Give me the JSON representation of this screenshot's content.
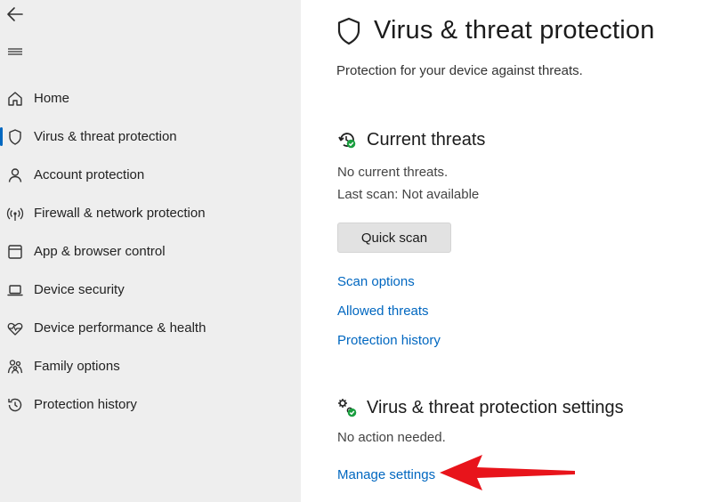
{
  "sidebar": {
    "back_icon": "back-arrow-icon",
    "menu_icon": "hamburger-menu-icon",
    "items": [
      {
        "label": "Home",
        "icon": "home-icon",
        "active": false
      },
      {
        "label": "Virus & threat protection",
        "icon": "shield-icon",
        "active": true
      },
      {
        "label": "Account protection",
        "icon": "person-icon",
        "active": false
      },
      {
        "label": "Firewall & network protection",
        "icon": "wireless-icon",
        "active": false
      },
      {
        "label": "App & browser control",
        "icon": "app-window-icon",
        "active": false
      },
      {
        "label": "Device security",
        "icon": "laptop-icon",
        "active": false
      },
      {
        "label": "Device performance & health",
        "icon": "heart-pulse-icon",
        "active": false
      },
      {
        "label": "Family options",
        "icon": "family-icon",
        "active": false
      },
      {
        "label": "Protection history",
        "icon": "history-icon",
        "active": false
      }
    ]
  },
  "main": {
    "title": "Virus & threat protection",
    "subtitle": "Protection for your device against threats.",
    "current_threats": {
      "title": "Current threats",
      "status": "No current threats.",
      "last_scan": "Last scan: Not available",
      "quick_scan_label": "Quick scan",
      "links": {
        "scan_options": "Scan options",
        "allowed_threats": "Allowed threats",
        "protection_history": "Protection history"
      }
    },
    "settings": {
      "title": "Virus & threat protection settings",
      "status": "No action needed.",
      "manage_link": "Manage settings"
    }
  },
  "colors": {
    "accent": "#0067c0",
    "sidebar_bg": "#eeeeee",
    "annotation_arrow": "#e8141b",
    "status_green": "#1a9e3f"
  }
}
